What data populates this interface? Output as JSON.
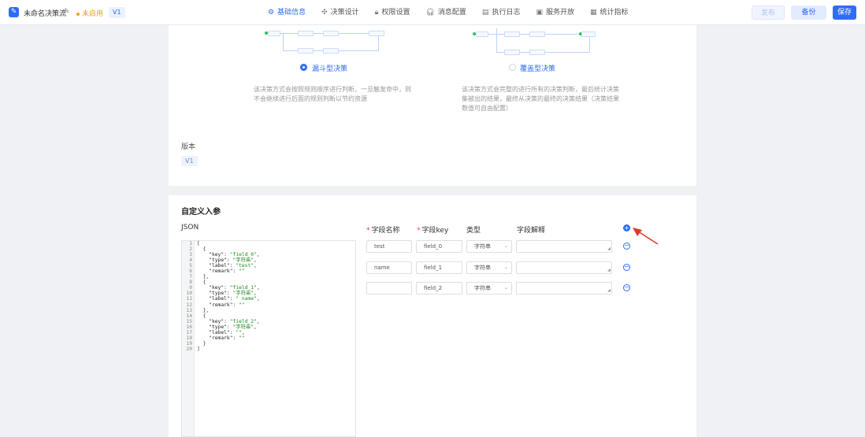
{
  "header": {
    "app_title": "未命名决策流",
    "status": "未启用",
    "version_badge": "V1",
    "tabs": [
      {
        "label": "基础信息",
        "icon": "gear-icon",
        "glyph": "⚙"
      },
      {
        "label": "决策设计",
        "icon": "move-icon",
        "glyph": "✣"
      },
      {
        "label": "权限设置",
        "icon": "lock-icon",
        "glyph": "🔒︎"
      },
      {
        "label": "消息配置",
        "icon": "headset-icon",
        "glyph": "🎧︎"
      },
      {
        "label": "执行日志",
        "icon": "document-icon",
        "glyph": "▤"
      },
      {
        "label": "服务开放",
        "icon": "window-icon",
        "glyph": "▣"
      },
      {
        "label": "统计指标",
        "icon": "chart-icon",
        "glyph": "▦"
      }
    ],
    "publish_label": "发布",
    "backup_label": "备份",
    "save_label": "保存"
  },
  "decision_types": {
    "funnel": {
      "label": "漏斗型决策",
      "selected": true,
      "description": "该决策方式会按照规则顺序进行判断，一旦触发命中，则不会继续进行后面的规则判断以节约资源"
    },
    "coverage": {
      "label": "覆盖型决策",
      "selected": false,
      "description": "该决策方式会完整的进行所有的决策判断，最后统计决策集被出的结果，最终从决策的最终的决策结果（决策结果数值可自由配置）"
    }
  },
  "version": {
    "label": "版本",
    "value": "V1"
  },
  "custom_params": {
    "title": "自定义入参",
    "json_label": "JSON",
    "json_lines": [
      "[",
      "  {",
      "    \"key\": \"field_0\",",
      "    \"type\": \"字符串\",",
      "    \"label\": \"test\",",
      "    \"remark\": \"\"",
      "  },",
      "  {",
      "    \"key\": \"field_1\",",
      "    \"type\": \"字符串\",",
      "    \"label\": \" name\",",
      "    \"remark\": \"\"",
      "  },",
      "  {",
      "    \"key\": \"field_2\",",
      "    \"type\": \"字符串\",",
      "    \"label\": \"\",",
      "    \"remark\": \"\"",
      "  }",
      "]"
    ],
    "columns": {
      "name": "字段名称",
      "key": "字段key",
      "type": "类型",
      "remark": "字段解释"
    },
    "rows": [
      {
        "name": "test",
        "key": "field_0",
        "type": "字符串",
        "remark": ""
      },
      {
        "name": "name",
        "key": "field_1",
        "type": "字符串",
        "remark": ""
      },
      {
        "name": "",
        "key": "field_2",
        "type": "字符串",
        "remark": ""
      }
    ]
  },
  "colors": {
    "accent": "#2e6cf6",
    "status": "#f0a020",
    "annotation_arrow": "#e03a2a"
  }
}
